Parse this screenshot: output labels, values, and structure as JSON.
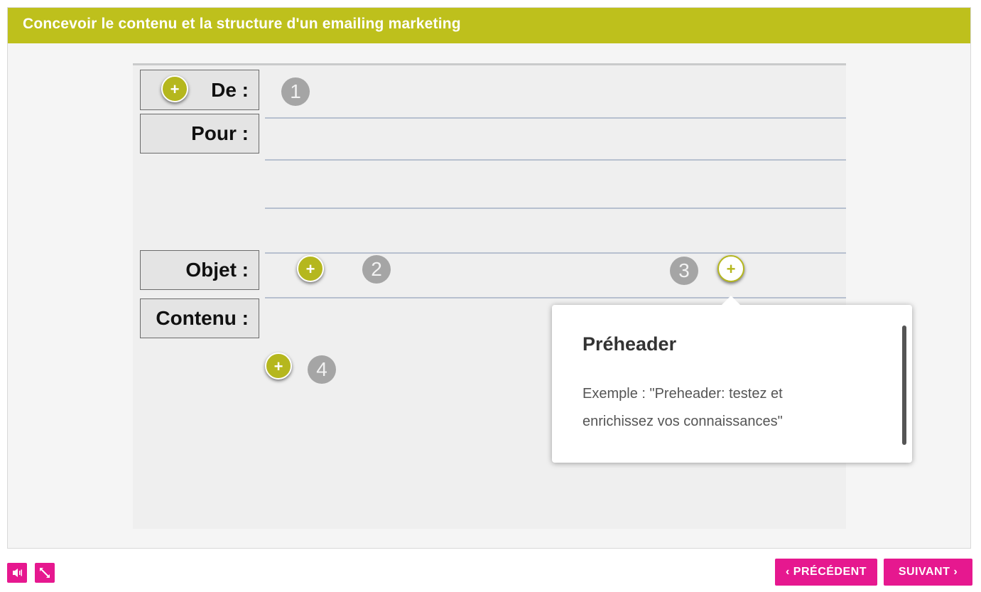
{
  "header": {
    "title": "Concevoir le contenu et la structure d'un emailing marketing"
  },
  "form": {
    "labels": {
      "de": "De :",
      "pour": "Pour :",
      "objet": "Objet :",
      "contenu": "Contenu :"
    }
  },
  "hotspots": [
    {
      "symbol": "+",
      "state": "closed"
    },
    {
      "symbol": "+",
      "state": "closed"
    },
    {
      "symbol": "+",
      "state": "open"
    },
    {
      "symbol": "+",
      "state": "closed"
    }
  ],
  "badges": [
    "1",
    "2",
    "3",
    "4"
  ],
  "popup": {
    "title": "Préheader",
    "body": "Exemple : \"Preheader: testez et enrichissez vos connaissances\""
  },
  "footer": {
    "audio_icon": "speaker-icon",
    "fullscreen_icon": "expand-icon",
    "prev_label": "PRÉCÉDENT",
    "next_label": "SUIVANT"
  },
  "colors": {
    "accent": "#bec01c",
    "nav": "#e6188f",
    "badge": "#a5a5a5"
  }
}
